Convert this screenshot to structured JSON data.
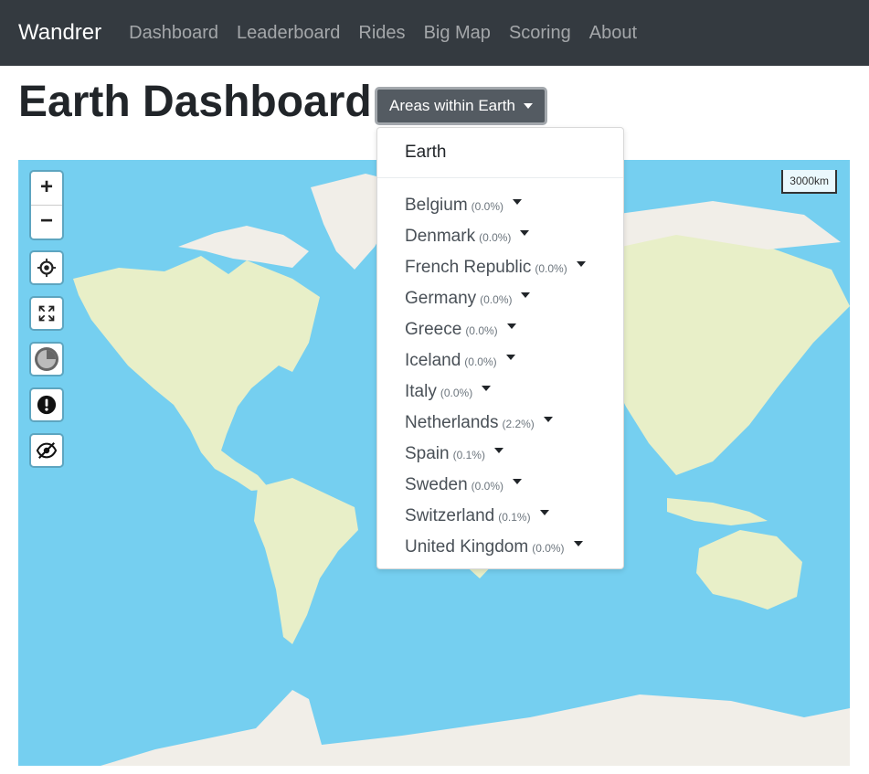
{
  "navbar": {
    "brand": "Wandrer",
    "links": [
      "Dashboard",
      "Leaderboard",
      "Rides",
      "Big Map",
      "Scoring",
      "About"
    ]
  },
  "page": {
    "title": "Earth Dashboard",
    "areas_button": "Areas within Earth"
  },
  "dropdown": {
    "top_item": "Earth",
    "items": [
      {
        "name": "Belgium",
        "pct": "(0.0%)"
      },
      {
        "name": "Denmark",
        "pct": "(0.0%)"
      },
      {
        "name": "French Republic",
        "pct": "(0.0%)"
      },
      {
        "name": "Germany",
        "pct": "(0.0%)"
      },
      {
        "name": "Greece",
        "pct": "(0.0%)"
      },
      {
        "name": "Iceland",
        "pct": "(0.0%)"
      },
      {
        "name": "Italy",
        "pct": "(0.0%)"
      },
      {
        "name": "Netherlands",
        "pct": "(2.2%)"
      },
      {
        "name": "Spain",
        "pct": "(0.1%)"
      },
      {
        "name": "Sweden",
        "pct": "(0.0%)"
      },
      {
        "name": "Switzerland",
        "pct": "(0.1%)"
      },
      {
        "name": "United Kingdom",
        "pct": "(0.0%)"
      }
    ]
  },
  "map": {
    "zoom_in": "+",
    "zoom_out": "−",
    "scale": "3000km",
    "controls": [
      "locate-icon",
      "fullscreen-icon",
      "clock-icon",
      "alert-icon",
      "eye-slash-icon"
    ],
    "colors": {
      "water": "#75cff0",
      "land": "#f1eee8",
      "vegetation": "#e8efc8"
    }
  }
}
